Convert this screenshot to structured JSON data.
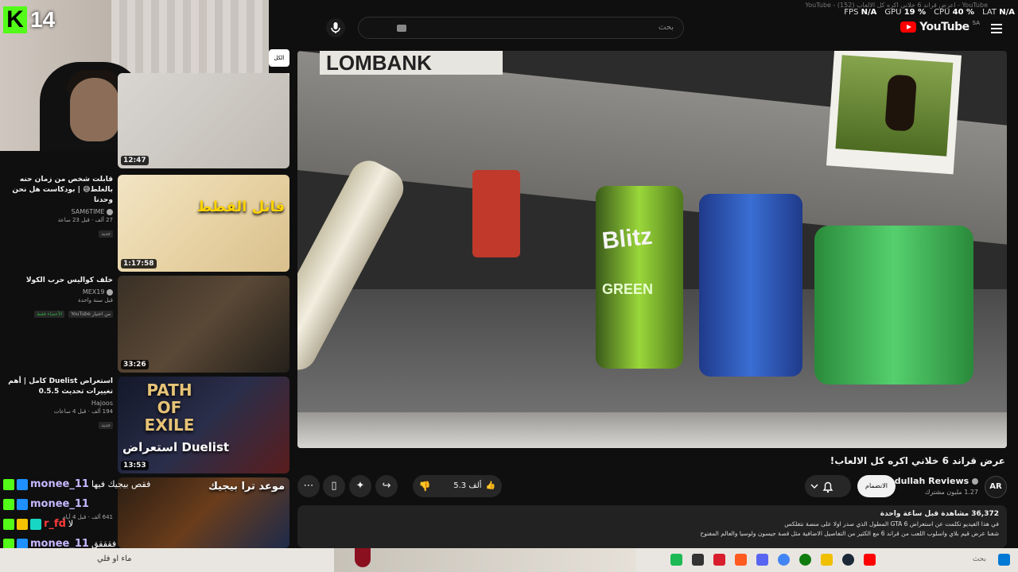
{
  "overlay": {
    "window_title": "YouTube - اعرض قراند 6 خلاني اكره كل الالعاب (152) - YouTube",
    "stats": [
      {
        "label": "FPS",
        "value": "N/A"
      },
      {
        "label": "GPU",
        "value": "19 %"
      },
      {
        "label": "CPU",
        "value": "40 %"
      },
      {
        "label": "LAT",
        "value": "N/A"
      }
    ]
  },
  "header": {
    "logo": "YouTube",
    "country": "SA",
    "search_placeholder": "بحث"
  },
  "stream": {
    "viewer_count": "14",
    "badge_letter": "K"
  },
  "side_chip": "الكل",
  "recommendations": [
    {
      "duration": "12:47",
      "title": "",
      "channel": "",
      "meta": "",
      "badge": ""
    },
    {
      "duration": "1:17:58",
      "title": "قابلت شخص من زمان حنه بالغلط😅 | بودكاست هل نحن وحدنا",
      "channel": "SAM6TIME",
      "meta": "27 ألف · قبل 23 ساعة",
      "badge": "جديد",
      "thumb_text": "قاتل القطط"
    },
    {
      "duration": "33:26",
      "title": "خلف كواليس حرب الكولا",
      "channel": "MEX19",
      "meta": "قبل سنة واحدة",
      "badge": "من اختيار YouTube",
      "badge2": "الأعضاء فقط"
    },
    {
      "duration": "13:53",
      "title": "استعراض Duelist كامل | أهم تغييرات تحديث 0.5.5",
      "channel": "Hajoos",
      "meta": "194 ألف · قبل 4 ساعات",
      "badge": "جديد",
      "thumb_text": "استعراض Duelist",
      "poe": "PATH OF EXILE"
    },
    {
      "duration": "",
      "title": "",
      "channel": "",
      "meta": "641 ألف · قبل 4 أيام",
      "badge": "",
      "thumb_text": "موعد ترا بيجيك"
    }
  ],
  "chat": [
    {
      "user": "monee_11",
      "msg": "فقص بيجيك فيها",
      "badges": [
        "green",
        "blue",
        "gold"
      ]
    },
    {
      "user": "monee_11",
      "msg": "",
      "badges": [
        "green",
        "blue"
      ]
    },
    {
      "user": "r_fd",
      "msg": "لا",
      "badges": [
        "green",
        "gold",
        "teal"
      ]
    },
    {
      "user": "monee_11",
      "msg": "فقققق",
      "badges": [
        "green",
        "blue"
      ]
    },
    {
      "user": "r_fd",
      "msg": "ماء او فلي",
      "badges": [
        "green",
        "blue",
        "teal"
      ]
    }
  ],
  "video": {
    "title": "عرض قراند 6 خلاني اكره كل الالعاب!",
    "channel_name": "Abdullah Reviews",
    "channel_initials": "AR",
    "subscribers": "1.27 مليون مشترك",
    "join_label": "الانضمام",
    "likes": "5.3 ألف",
    "views_line": "36,372 مشاهدة  قبل ساعة واحدة",
    "desc_line1": "في هذا الفيديو تكلمت عن استعراض GTA 6 المطول الذي صدر اولا على منصة نتفلكس",
    "desc_line2": "شفنا عرض قيم بلاي واسلوب اللعب من قراند 6 مع الكثير من التفاصيل الاضافية مثل قصة جيسون ولوسيا والعالم المفتوح",
    "shelf_sign": "LOMBANK",
    "can_brand": "Blitz",
    "can_label": "GREEN"
  },
  "taskbar": {
    "search_text": "بحث",
    "input_text": "ماء او فلي"
  }
}
